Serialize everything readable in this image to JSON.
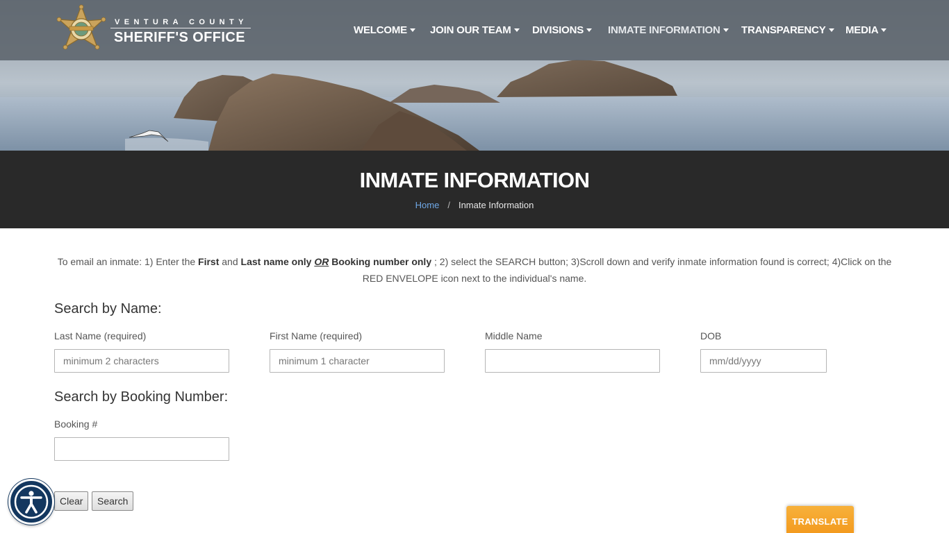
{
  "header": {
    "brand_top": "VENTURA COUNTY",
    "brand_main": "SHERIFF'S OFFICE",
    "nav": [
      {
        "label": "WELCOME"
      },
      {
        "label": "JOIN OUR TEAM"
      },
      {
        "label": "DIVISIONS"
      },
      {
        "label": "INMATE INFORMATION"
      },
      {
        "label": "TRANSPARENCY"
      },
      {
        "label": "MEDIA"
      }
    ]
  },
  "title_band": {
    "title": "INMATE INFORMATION",
    "breadcrumb_home": "Home",
    "breadcrumb_sep": "/",
    "breadcrumb_current": "Inmate Information"
  },
  "instructions": {
    "t1": "To email an inmate: 1) Enter the ",
    "first": "First",
    "t2": " and ",
    "last_only": "Last name only",
    "or": "OR",
    "booking_only": "Booking number only",
    "t3": " ; 2) select the SEARCH button;  3)Scroll down and verify inmate information found is correct; 4)Click on the RED ENVELOPE icon next to the individual's name."
  },
  "search_by_name": {
    "heading": "Search by Name:",
    "last_label": "Last Name (required)",
    "last_placeholder": "minimum 2 characters",
    "first_label": "First Name (required)",
    "first_placeholder": "minimum 1 character",
    "middle_label": "Middle Name",
    "middle_placeholder": "",
    "dob_label": "DOB",
    "dob_placeholder": "mm/dd/yyyy"
  },
  "search_by_booking": {
    "heading": "Search by Booking Number:",
    "booking_label": "Booking #",
    "booking_placeholder": ""
  },
  "buttons": {
    "clear": "Clear",
    "search": "Search"
  },
  "widgets": {
    "translate": "TRANSLATE",
    "accessibility_icon": "accessibility-icon"
  },
  "colors": {
    "header_bg": "#5c646c",
    "title_band_bg": "#292929",
    "link": "#6fa8e6",
    "a11y": "#13375f",
    "translate": "#f5a52a"
  }
}
